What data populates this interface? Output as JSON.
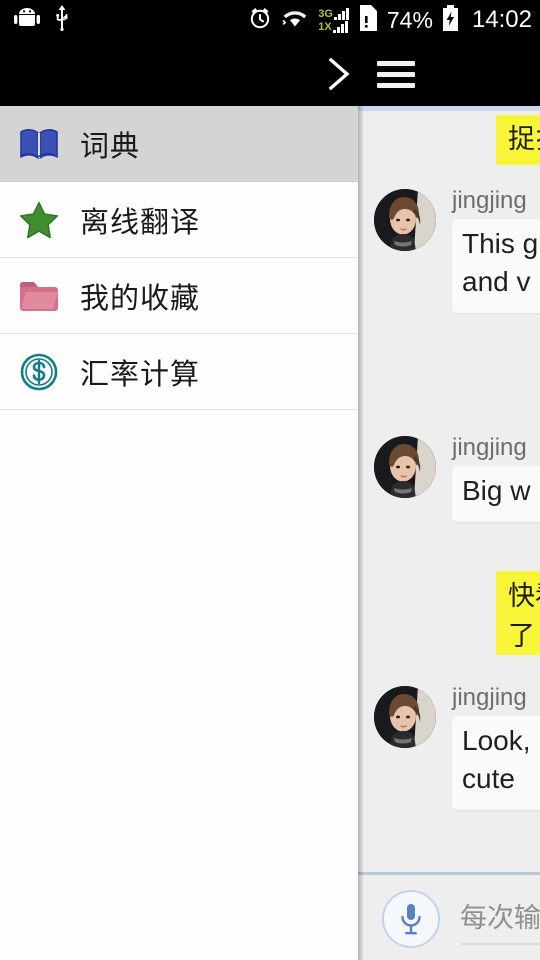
{
  "status_bar": {
    "icons_left": [
      "android-robot-icon",
      "usb-icon"
    ],
    "alarm_icon": "alarm-clock-icon",
    "wifi_icon": "wifi-icon",
    "signal_3g_label": "3G",
    "signal_1x_label": "1X",
    "sim_icon": "sim-card-alert-icon",
    "battery_percent": "74%",
    "battery_icon": "battery-charging-icon",
    "clock": "14:02"
  },
  "action_bar": {
    "chevron_icon": "chevron-right-icon",
    "menu_icon": "hamburger-menu-icon"
  },
  "drawer": {
    "items": [
      {
        "label": "词典",
        "icon": "open-book-icon",
        "icon_color": "#2b3f9e",
        "selected": true
      },
      {
        "label": "离线翻译",
        "icon": "star-icon",
        "icon_color": "#3c8b2e",
        "selected": false
      },
      {
        "label": "我的收藏",
        "icon": "folder-icon",
        "icon_color": "#d4708a",
        "selected": false
      },
      {
        "label": "汇率计算",
        "icon": "dollar-circle-icon",
        "icon_color": "#137e86",
        "selected": false
      }
    ]
  },
  "chat": {
    "sender_name": "jingjing",
    "avatar_icon": "user-avatar-photo",
    "messages": [
      {
        "type": "outgoing",
        "text": "捉扌",
        "bubble_color": "#f9f539"
      },
      {
        "type": "incoming",
        "name": "jingjing",
        "text": "This g\nand v"
      },
      {
        "type": "incoming",
        "name": "jingjing",
        "text": "Big w"
      },
      {
        "type": "outgoing",
        "text": "快看\n了",
        "bubble_color": "#f9f539"
      },
      {
        "type": "incoming",
        "name": "jingjing",
        "text": "Look,\ncute"
      }
    ]
  },
  "input_bar": {
    "mic_icon": "microphone-icon",
    "input_value": "",
    "input_placeholder": "每次输"
  },
  "colors": {
    "chat_background": "#eeeeee",
    "drawer_background": "#fdfdfd",
    "drawer_selected": "#d4d4d4",
    "accent_blue": "#5b8cc8",
    "status_bar": "#000000"
  }
}
